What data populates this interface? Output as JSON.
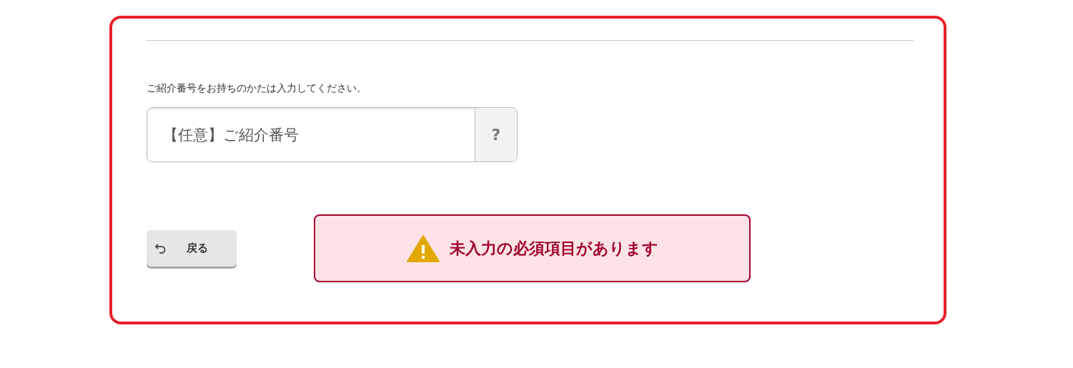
{
  "referral": {
    "label": "ご紹介番号をお持ちのかたは入力してください。",
    "placeholder": "【任意】ご紹介番号",
    "help_button": "?"
  },
  "back_button": {
    "label": "戻る"
  },
  "alert": {
    "message": "未入力の必須項目があります"
  }
}
